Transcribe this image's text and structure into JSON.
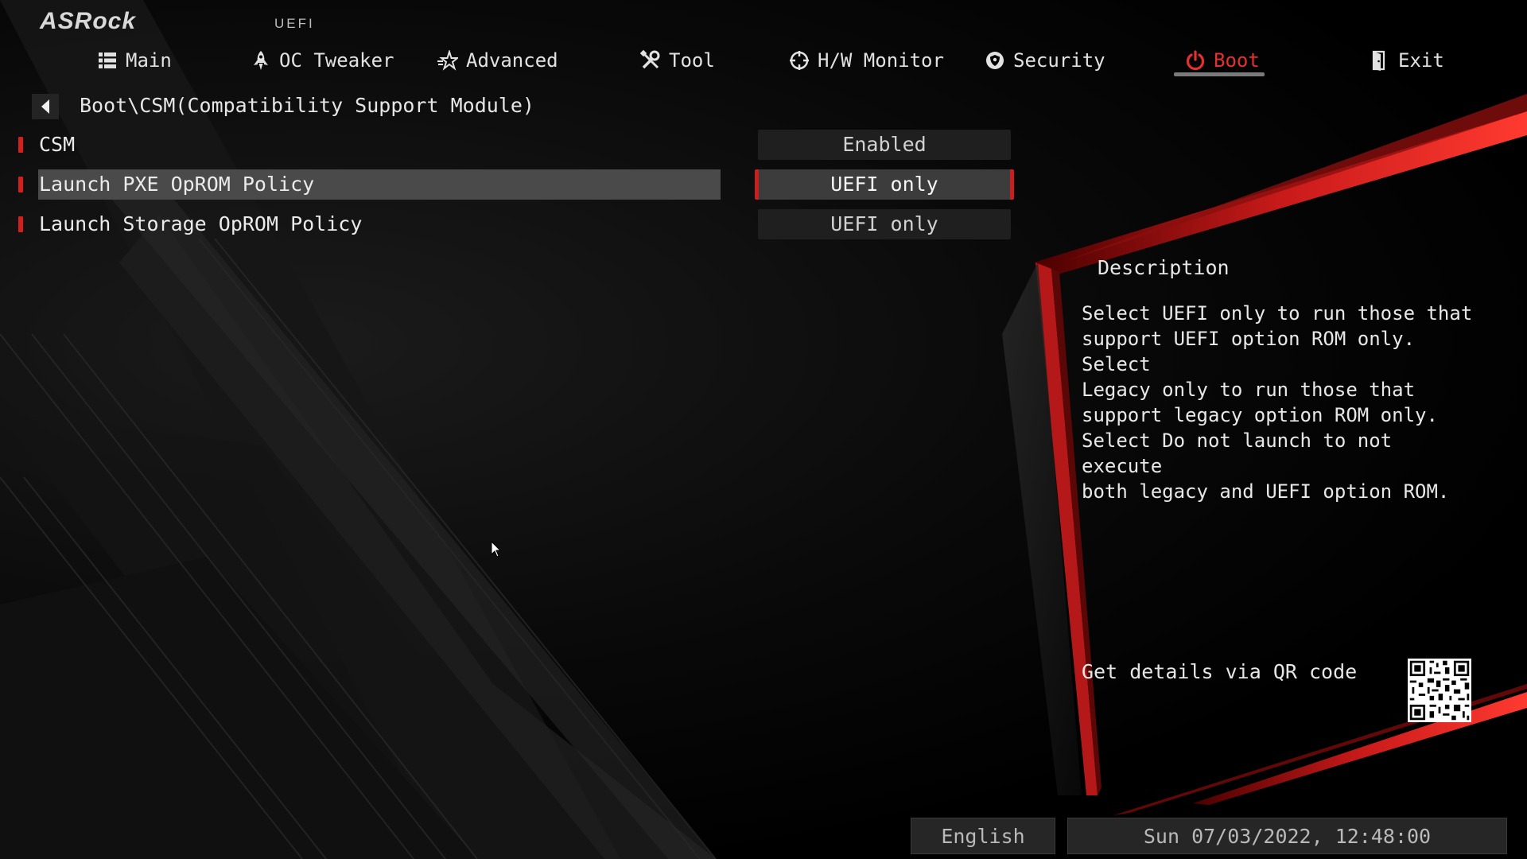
{
  "brand": {
    "logo": "ASRock",
    "tag": "UEFI"
  },
  "nav": [
    {
      "label": "Main",
      "icon": "list-icon"
    },
    {
      "label": "OC Tweaker",
      "icon": "rocket-icon"
    },
    {
      "label": "Advanced",
      "icon": "star-icon"
    },
    {
      "label": "Tool",
      "icon": "tools-icon"
    },
    {
      "label": "H/W Monitor",
      "icon": "crosshair-icon"
    },
    {
      "label": "Security",
      "icon": "shield-icon"
    },
    {
      "label": "Boot",
      "icon": "power-icon",
      "active": true
    },
    {
      "label": "Exit",
      "icon": "door-icon"
    }
  ],
  "breadcrumb": "Boot\\CSM(Compatibility Support Module)",
  "settings": [
    {
      "label": "CSM",
      "value": "Enabled"
    },
    {
      "label": "Launch PXE OpROM Policy",
      "value": "UEFI only",
      "selected": true
    },
    {
      "label": "Launch Storage OpROM Policy",
      "value": "UEFI only"
    }
  ],
  "description": {
    "title": "Description",
    "lines": [
      "Select UEFI only to run those that",
      "support UEFI option ROM only. Select",
      "Legacy only to run those that",
      "support legacy option ROM only.",
      "Select Do not launch to not execute",
      "both legacy and UEFI option ROM."
    ]
  },
  "qr": {
    "label": "Get details via QR code"
  },
  "status": {
    "language": "English",
    "datetime": "Sun 07/03/2022, 12:48:00"
  },
  "colors": {
    "accent_red": "#d3201f",
    "active_nav": "#e5302e",
    "highlight": "#4a4a4a"
  }
}
